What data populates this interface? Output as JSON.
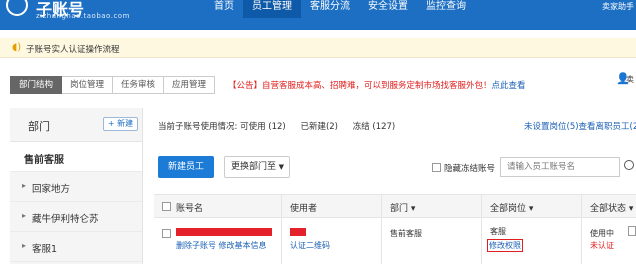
{
  "header": {
    "app_title": "子账号",
    "app_subtitle": "zizhanghao.taobao.com",
    "nav": [
      "首页",
      "员工管理",
      "客服分流",
      "安全设置",
      "监控查询"
    ],
    "active_nav": 1,
    "right_label": "卖家助手"
  },
  "notice": {
    "text": "子账号实人认证操作流程"
  },
  "tabs": [
    "部门结构",
    "岗位管理",
    "任务审核",
    "应用管理"
  ],
  "announcement": {
    "text": "【公告】自营客服成本高、招聘难，可以到服务定制市场找客服外包！",
    "link": "点此查看"
  },
  "user_label": "卖",
  "sidebar": {
    "title": "部门",
    "add_button": "+ 新建",
    "items": [
      "售前客服",
      "回家地方",
      "藏牛伊利特仑苏",
      "客服1"
    ]
  },
  "stats": {
    "label": "当前子账号使用情况:",
    "used": "可使用 (12)",
    "created": "已新建(2)",
    "frozen": "冻结 (127)",
    "right_link": "未设置岗位(5)查看离职员工(27)"
  },
  "toolbar": {
    "new_employee": "新建员工",
    "change_dept": "更换部门至",
    "hide_label": "隐藏冻结账号",
    "search_placeholder": "请输入员工账号名"
  },
  "table": {
    "columns": [
      "账号名",
      "使用者",
      "部门",
      "全部岗位",
      "全部状态"
    ],
    "rows": [
      {
        "account_actions": "删除子账号 修改基本信息",
        "user_action": "认证二维码",
        "department": "售前客服",
        "position": "客服",
        "position_action": "修改权限",
        "status": "使用中",
        "auth_status": "未认证"
      }
    ]
  }
}
